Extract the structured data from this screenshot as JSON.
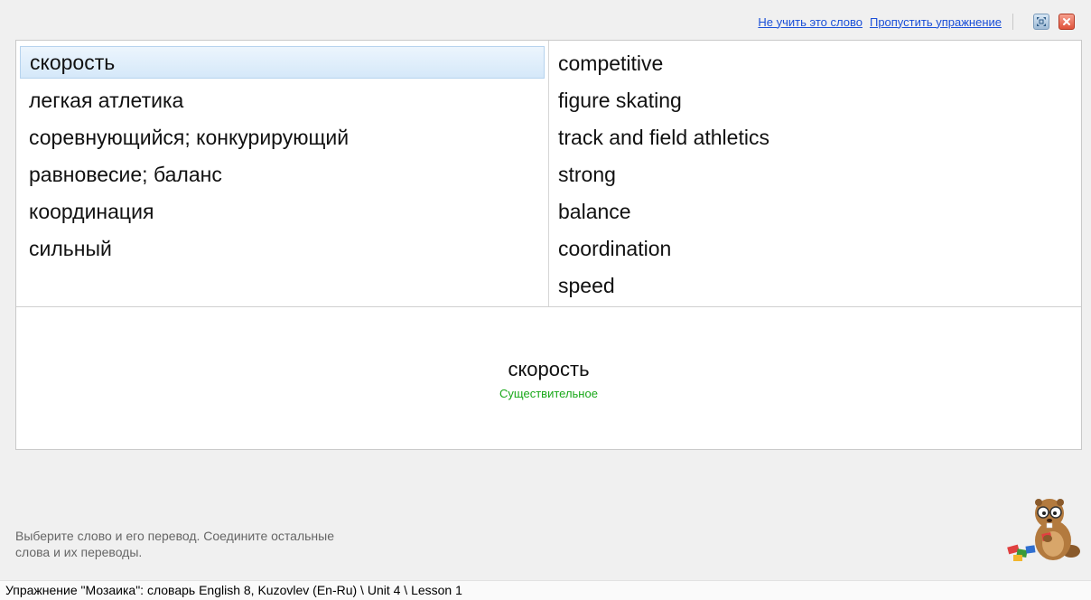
{
  "toolbar": {
    "dont_learn_label": "Не учить это слово",
    "skip_label": "Пропустить упражнение",
    "maximize_icon": "maximize-icon",
    "close_icon": "close-icon"
  },
  "left_words": [
    {
      "text": "скорость",
      "selected": true
    },
    {
      "text": "легкая атлетика"
    },
    {
      "text": "соревнующийся; конкурирующий"
    },
    {
      "text": "равновесие; баланс"
    },
    {
      "text": "координация"
    },
    {
      "text": "сильный"
    }
  ],
  "right_words": [
    {
      "text": "competitive"
    },
    {
      "text": "figure skating"
    },
    {
      "text": "track and field athletics"
    },
    {
      "text": "strong"
    },
    {
      "text": "balance"
    },
    {
      "text": "coordination"
    },
    {
      "text": "speed"
    }
  ],
  "preview": {
    "word": "скорость",
    "part_of_speech": "Существительное"
  },
  "hint": "Выберите слово и его перевод. Соедините остальные слова и их переводы.",
  "status": "Упражнение \"Мозаика\": словарь English 8, Kuzovlev (En-Ru) \\ Unit 4 \\ Lesson 1",
  "colors": {
    "link": "#1a4fd8",
    "pos_green": "#18a818",
    "selection": "#d5e8f9"
  }
}
